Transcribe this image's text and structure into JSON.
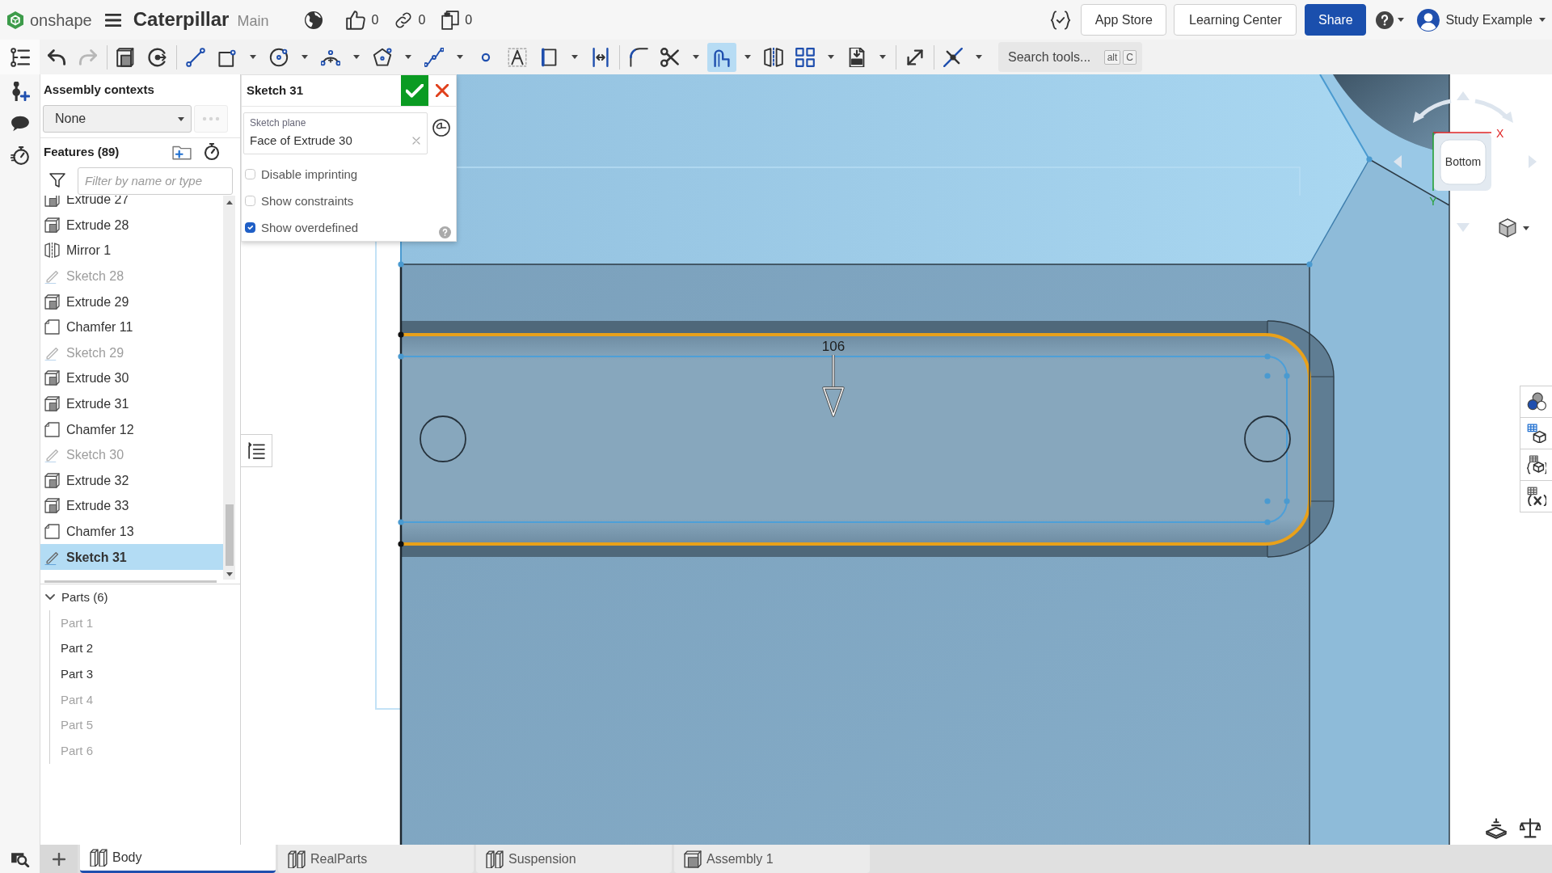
{
  "top_bar": {
    "logo_text": "onshape",
    "document_title": "Caterpillar",
    "workspace": "Main",
    "likes": "0",
    "links": "0",
    "copies": "0",
    "buttons": [
      {
        "label": "App Store",
        "kind": "outline"
      },
      {
        "label": "Learning Center",
        "kind": "outline"
      },
      {
        "label": "Share",
        "kind": "primary"
      }
    ],
    "user_name": "Study Example"
  },
  "toolbar": {
    "groups": [
      [
        {
          "kind": "undo",
          "dropdown": false,
          "selected": false,
          "disabled": false
        },
        {
          "kind": "redo",
          "dropdown": false,
          "selected": false,
          "disabled": true
        }
      ],
      [
        {
          "kind": "part",
          "dropdown": false,
          "selected": false,
          "disabled": false
        },
        {
          "kind": "sketch_plane",
          "dropdown": false,
          "selected": false,
          "disabled": false
        }
      ],
      [
        {
          "kind": "line",
          "dropdown": false,
          "selected": false,
          "disabled": false
        },
        {
          "kind": "rectangle",
          "dropdown": true,
          "selected": false,
          "disabled": false
        },
        {
          "kind": "circle",
          "dropdown": true,
          "selected": false,
          "disabled": false
        },
        {
          "kind": "arc",
          "dropdown": true,
          "selected": false,
          "disabled": false
        },
        {
          "kind": "polygon",
          "dropdown": true,
          "selected": false,
          "disabled": false
        },
        {
          "kind": "spline",
          "dropdown": true,
          "selected": false,
          "disabled": false
        },
        {
          "kind": "point",
          "dropdown": false,
          "selected": false,
          "disabled": false
        },
        {
          "kind": "text",
          "dropdown": false,
          "selected": false,
          "disabled": false
        },
        {
          "kind": "construction",
          "dropdown": true,
          "selected": false,
          "disabled": false
        },
        {
          "kind": "dimension",
          "dropdown": false,
          "selected": false,
          "disabled": false
        }
      ],
      [
        {
          "kind": "fillet",
          "dropdown": false,
          "selected": false,
          "disabled": false
        },
        {
          "kind": "trim",
          "dropdown": true,
          "selected": false,
          "disabled": false
        },
        {
          "kind": "offset",
          "dropdown": true,
          "selected": true,
          "disabled": false
        },
        {
          "kind": "mirror",
          "dropdown": false,
          "selected": false,
          "disabled": false
        },
        {
          "kind": "pattern",
          "dropdown": true,
          "selected": false,
          "disabled": false
        },
        {
          "kind": "dxf_import",
          "dropdown": true,
          "selected": false,
          "disabled": false
        }
      ],
      [
        {
          "kind": "transform",
          "dropdown": false,
          "selected": false,
          "disabled": false
        }
      ],
      [
        {
          "kind": "intersection",
          "dropdown": true,
          "selected": false,
          "disabled": false
        }
      ]
    ],
    "search": {
      "placeholder": "Search tools...",
      "keys": [
        "alt",
        "C"
      ]
    }
  },
  "feature_panel": {
    "assembly_contexts": {
      "title": "Assembly contexts",
      "value": "None"
    },
    "features": {
      "title": "Features (89)",
      "filter_placeholder": "Filter by name or type",
      "items": [
        {
          "kind": "extrude",
          "name": "Extrude 27",
          "hidden": false,
          "selected": false
        },
        {
          "kind": "extrude",
          "name": "Extrude 28",
          "hidden": false,
          "selected": false
        },
        {
          "kind": "mirror",
          "name": "Mirror 1",
          "hidden": false,
          "selected": false
        },
        {
          "kind": "sketch",
          "name": "Sketch 28",
          "hidden": true,
          "selected": false
        },
        {
          "kind": "extrude",
          "name": "Extrude 29",
          "hidden": false,
          "selected": false
        },
        {
          "kind": "chamfer",
          "name": "Chamfer 11",
          "hidden": false,
          "selected": false
        },
        {
          "kind": "sketch",
          "name": "Sketch 29",
          "hidden": true,
          "selected": false
        },
        {
          "kind": "extrude",
          "name": "Extrude 30",
          "hidden": false,
          "selected": false
        },
        {
          "kind": "extrude",
          "name": "Extrude 31",
          "hidden": false,
          "selected": false
        },
        {
          "kind": "chamfer",
          "name": "Chamfer 12",
          "hidden": false,
          "selected": false
        },
        {
          "kind": "sketch",
          "name": "Sketch 30",
          "hidden": true,
          "selected": false
        },
        {
          "kind": "extrude",
          "name": "Extrude 32",
          "hidden": false,
          "selected": false
        },
        {
          "kind": "extrude",
          "name": "Extrude 33",
          "hidden": false,
          "selected": false
        },
        {
          "kind": "chamfer",
          "name": "Chamfer 13",
          "hidden": false,
          "selected": false
        },
        {
          "kind": "sketch",
          "name": "Sketch 31",
          "hidden": false,
          "selected": true
        }
      ]
    },
    "parts": {
      "title": "Parts (6)",
      "expanded": true,
      "items": [
        {
          "name": "Part 1",
          "hidden": true
        },
        {
          "name": "Part 2",
          "hidden": false
        },
        {
          "name": "Part 3",
          "hidden": false
        },
        {
          "name": "Part 4",
          "hidden": true
        },
        {
          "name": "Part 5",
          "hidden": true
        },
        {
          "name": "Part 6",
          "hidden": true
        }
      ]
    }
  },
  "sketch_dialog": {
    "title": "Sketch 31",
    "plane_label": "Sketch plane",
    "plane_value": "Face of Extrude 30",
    "options": [
      {
        "label": "Disable imprinting",
        "checked": false
      },
      {
        "label": "Show constraints",
        "checked": false
      },
      {
        "label": "Show overdefined",
        "checked": true
      }
    ]
  },
  "viewport": {
    "dimension": "106",
    "view_cube": {
      "face": "Bottom",
      "x_axis": "X",
      "y_axis": "Y"
    }
  },
  "tabs": [
    {
      "label": "Body",
      "kind": "part_studio",
      "selected": true
    },
    {
      "label": "RealParts",
      "kind": "part_studio",
      "selected": false
    },
    {
      "label": "Suspension",
      "kind": "part_studio",
      "selected": false
    },
    {
      "label": "Assembly 1",
      "kind": "assembly",
      "selected": false
    }
  ]
}
